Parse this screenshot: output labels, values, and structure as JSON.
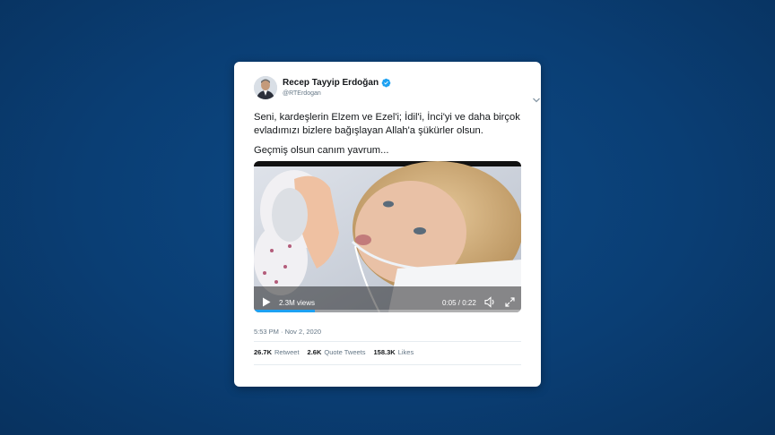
{
  "tweet": {
    "author": {
      "display_name": "Recep Tayyip Erdoğan",
      "handle": "@RTErdogan",
      "verified": true,
      "avatar_icon": "portrait-avatar"
    },
    "menu_icon": "chevron-down-icon",
    "text_paragraph_1": "Seni, kardeşlerin Elzem ve Ezel'i; İdil'i, İnci'yi ve daha birçok evladımızı bizlere bağışlayan Allah'a şükürler olsun.",
    "text_paragraph_2": "Geçmiş olsun canım yavrum...",
    "video": {
      "views": "2.3M views",
      "elapsed_time": "0:05",
      "total_time": "0:22",
      "time_display": "0:05 / 0:22",
      "progress_fraction": 0.227
    },
    "timestamp": "5:53 PM · Nov 2, 2020",
    "stats": {
      "retweets_count": "26.7K",
      "retweets_label": "Retweet",
      "quotes_count": "2.6K",
      "quotes_label": "Quote Tweets",
      "likes_count": "158.3K",
      "likes_label": "Likes"
    }
  },
  "colors": {
    "background": "#0a3e74",
    "card": "#ffffff",
    "verified_badge": "#1da1f2",
    "muted_text": "#657786"
  }
}
